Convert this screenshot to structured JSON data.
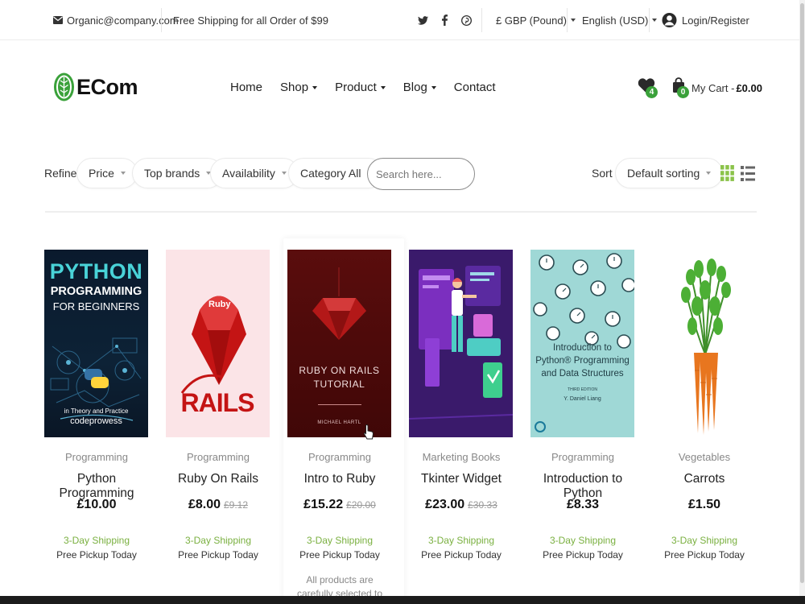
{
  "topbar": {
    "email": "Organic@company.com",
    "shipping_notice": "Free Shipping for all Order of $99",
    "social": [
      "twitter-icon",
      "facebook-icon",
      "pinterest-icon"
    ],
    "currency": "£ GBP (Pound)",
    "language": "English (USD)",
    "login": "Login/Register"
  },
  "header": {
    "logo_text": "ECom",
    "nav": [
      {
        "label": "Home",
        "dropdown": false
      },
      {
        "label": "Shop",
        "dropdown": true
      },
      {
        "label": "Product",
        "dropdown": true
      },
      {
        "label": "Blog",
        "dropdown": true
      },
      {
        "label": "Contact",
        "dropdown": false
      }
    ],
    "wishlist_count": "4",
    "cart_count": "0",
    "cart_label": "My Cart -",
    "cart_total": "£0.00"
  },
  "filters": {
    "refine_label": "Refine",
    "price": "Price",
    "brands": "Top brands",
    "availability": "Availability",
    "category": "Category All",
    "search_placeholder": "Search here...",
    "sort_label": "Sort",
    "sort_value": "Default sorting"
  },
  "products": [
    {
      "category": "Programming",
      "name": "Python Programming",
      "price": "£10.00",
      "old_price": "",
      "shipping": "3-Day Shipping",
      "pickup": "Pree Pickup Today",
      "cover": {
        "title_lines": [
          "PYTHON",
          "PROGRAMMING",
          "FOR BEGINNERS"
        ],
        "subtitle": "in Theory and Practice",
        "author": "codeprowess"
      }
    },
    {
      "category": "Programming",
      "name": "Ruby On Rails",
      "price": "£8.00",
      "old_price": "£9.12",
      "shipping": "3-Day Shipping",
      "pickup": "Pree Pickup Today",
      "cover": {
        "gem_label": "Ruby",
        "word": "RAILS"
      }
    },
    {
      "category": "Programming",
      "name": "Intro to Ruby",
      "price": "£15.22",
      "old_price": "£20.00",
      "shipping": "3-Day Shipping",
      "pickup": "Pree Pickup Today",
      "description": "All products are carefully selected to ensure",
      "cover": {
        "title_lines": [
          "RUBY ON RAILS",
          "TUTORIAL"
        ],
        "author": "MICHAEL HARTL"
      }
    },
    {
      "category": "Marketing Books",
      "name": "Tkinter Widget",
      "price": "£23.00",
      "old_price": "£30.33",
      "shipping": "3-Day Shipping",
      "pickup": "Pree Pickup Today"
    },
    {
      "category": "Programming",
      "name": "Introduction to Python",
      "price": "£8.33",
      "old_price": "",
      "shipping": "3-Day Shipping",
      "pickup": "Pree Pickup Today",
      "cover": {
        "title_lines": [
          "Introduction to",
          "Python® Programming",
          "and Data Structures"
        ],
        "edition": "THIRD EDITION",
        "author": "Y. Daniel Liang"
      }
    },
    {
      "category": "Vegetables",
      "name": "Carrots",
      "price": "£1.50",
      "old_price": "",
      "shipping": "3-Day Shipping",
      "pickup": "Pree Pickup Today"
    }
  ],
  "colors": {
    "brand_green": "#3aa13a",
    "shipping_green": "#7ab040"
  }
}
